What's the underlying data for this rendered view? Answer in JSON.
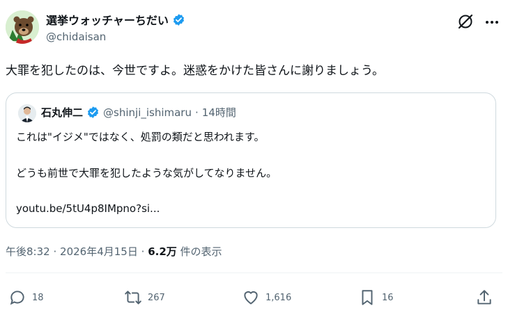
{
  "author": {
    "display_name": "選挙ウォッチャーちだい",
    "handle": "@chidaisan"
  },
  "tweet": {
    "text": "大罪を犯したのは、今世ですよ。迷惑をかけた皆さんに謝りましょう。"
  },
  "quoted": {
    "display_name": "石丸伸二",
    "handle": "@shinji_ishimaru",
    "separator": "·",
    "time": "14時間",
    "line1": "これは\"イジメ\"ではなく、処罰の類だと思われます。",
    "line2": "どうも前世で大罪を犯したような気がしてなりません。",
    "link": "youtu.be/5tU4p8IMpno?si..."
  },
  "meta": {
    "time": "午後8:32",
    "dot1": "·",
    "date": "2026年4月15日",
    "dot2": "·",
    "views": "6.2万",
    "views_label": "件の表示"
  },
  "actions": {
    "replies": "18",
    "retweets": "267",
    "likes": "1,616",
    "bookmarks": "16"
  },
  "colors": {
    "verified": "#1d9bf0",
    "secondary_text": "#536471",
    "border": "#cfd9de"
  }
}
